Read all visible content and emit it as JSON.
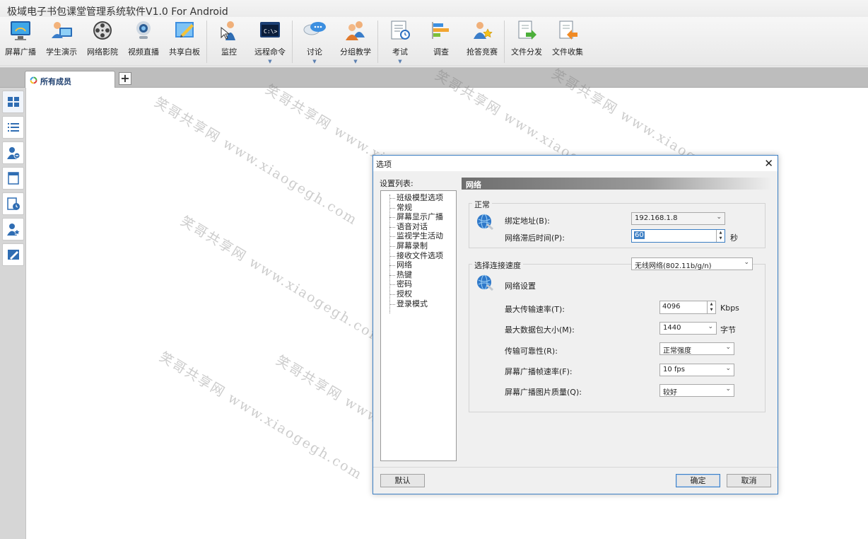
{
  "app": {
    "title": "极域电子书包课堂管理系统软件V1.0 For Android"
  },
  "toolbar": {
    "items": [
      {
        "label": "屏幕广播",
        "icon": "screen-broadcast-icon",
        "dropdown": false
      },
      {
        "label": "学生演示",
        "icon": "student-demo-icon",
        "dropdown": false
      },
      {
        "label": "网络影院",
        "icon": "film-reel-icon",
        "dropdown": false
      },
      {
        "label": "视频直播",
        "icon": "webcam-icon",
        "dropdown": false
      },
      {
        "label": "共享白板",
        "icon": "whiteboard-icon",
        "dropdown": false
      },
      {
        "label": "监控",
        "icon": "monitor-person-icon",
        "dropdown": false
      },
      {
        "label": "远程命令",
        "icon": "command-prompt-icon",
        "dropdown": true
      },
      {
        "label": "讨论",
        "icon": "chat-bubbles-icon",
        "dropdown": true
      },
      {
        "label": "分组教学",
        "icon": "group-users-icon",
        "dropdown": true
      },
      {
        "label": "考试",
        "icon": "exam-clock-icon",
        "dropdown": true
      },
      {
        "label": "调查",
        "icon": "survey-bars-icon",
        "dropdown": false
      },
      {
        "label": "抢答竞赛",
        "icon": "quiz-star-icon",
        "dropdown": false
      },
      {
        "label": "文件分发",
        "icon": "file-send-icon",
        "dropdown": false
      },
      {
        "label": "文件收集",
        "icon": "file-collect-icon",
        "dropdown": false
      }
    ],
    "dropdown_glyph": "▼"
  },
  "tabs": {
    "active_label": "所有成员",
    "add_glyph": "+"
  },
  "sidebar": {
    "items": [
      {
        "icon": "grid-view-icon"
      },
      {
        "icon": "list-view-icon"
      },
      {
        "icon": "user-remove-icon"
      },
      {
        "icon": "document-icon"
      },
      {
        "icon": "clock-document-icon"
      },
      {
        "icon": "user-star-icon"
      },
      {
        "icon": "pen-board-icon"
      }
    ]
  },
  "watermark": {
    "text": "笑哥共享网 www.xiaogegh.com"
  },
  "dialog": {
    "title": "选项",
    "close_glyph": "✕",
    "settings_list_label": "设置列表:",
    "tree_items": [
      "班级模型选项",
      "常规",
      "屏幕显示广播",
      "语音对话",
      "监视学生活动",
      "屏幕录制",
      "接收文件选项",
      "网络",
      "热键",
      "密码",
      "授权",
      "登录模式"
    ],
    "section_title": "网络",
    "general_group": {
      "title": "正常",
      "bind_address_label": "绑定地址(B):",
      "bind_address_value": "192.168.1.8",
      "timeout_label": "网络滞后时间(P):",
      "timeout_value": "60",
      "timeout_unit": "秒"
    },
    "speed_group": {
      "title": "选择连接速度",
      "speed_value": "无线网络(802.11b/g/n)",
      "network_settings_label": "网络设置",
      "max_rate_label": "最大传输速率(T):",
      "max_rate_value": "4096",
      "max_rate_unit": "Kbps",
      "max_packet_label": "最大数据包大小(M):",
      "max_packet_value": "1440",
      "max_packet_unit": "字节",
      "reliability_label": "传输可靠性(R):",
      "reliability_value": "正常强度",
      "fps_label": "屏幕广播帧速率(F):",
      "fps_value": "10 fps",
      "quality_label": "屏幕广播图片质量(Q):",
      "quality_value": "较好"
    },
    "default_button": "默认",
    "ok_button": "确定",
    "cancel_button": "取消"
  },
  "colors": {
    "accent": "#3c7fc4",
    "tab_text": "#1d3e6e"
  }
}
